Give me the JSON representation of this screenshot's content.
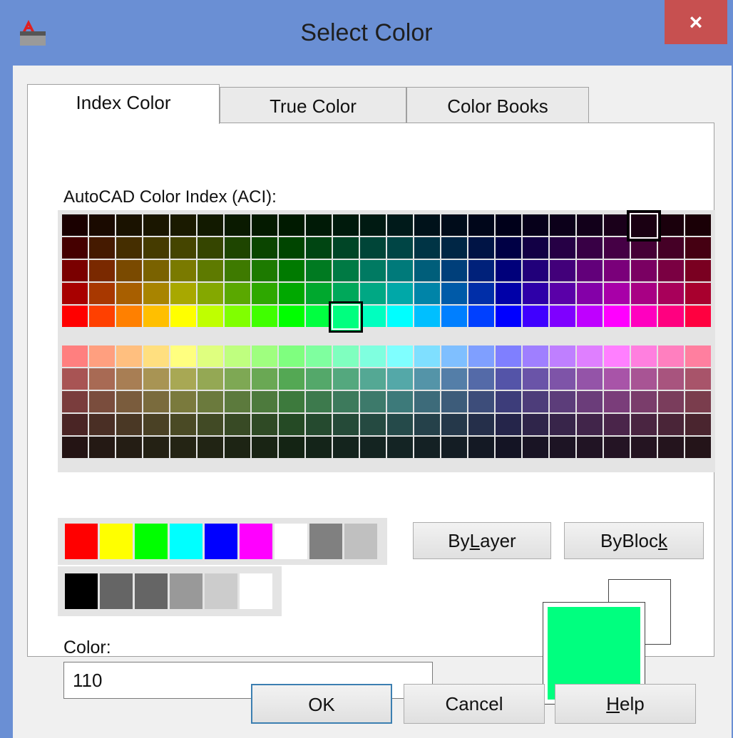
{
  "window": {
    "title": "Select Color",
    "close_glyph": "×",
    "app_icon": "autocad-a-icon"
  },
  "tabs": [
    {
      "label": "Index Color",
      "active": true
    },
    {
      "label": "True Color",
      "active": false
    },
    {
      "label": "Color Books",
      "active": false
    }
  ],
  "aci": {
    "label": "AutoCAD Color Index (ACI):",
    "top_rows": [
      [
        "#1a0000",
        "#1a0a00",
        "#1a1200",
        "#1a1600",
        "#1a1a00",
        "#121a00",
        "#0a1a00",
        "#041a00",
        "#001a00",
        "#001a06",
        "#001a0c",
        "#001a12",
        "#001a1a",
        "#00121a",
        "#000c1a",
        "#00061a",
        "#00001a",
        "#06001a",
        "#0c001a",
        "#12001a",
        "#1a001a",
        "#1a0012",
        "#1a000c",
        "#1a0006"
      ],
      [
        "#450000",
        "#451a00",
        "#452e00",
        "#453b00",
        "#454500",
        "#354500",
        "#1e4500",
        "#0b4500",
        "#004500",
        "#004512",
        "#004526",
        "#004538",
        "#004545",
        "#003445",
        "#002645",
        "#001445",
        "#000045",
        "#120045",
        "#260045",
        "#380045",
        "#450045",
        "#450036",
        "#450026",
        "#450012"
      ],
      [
        "#7a0000",
        "#7a2900",
        "#7a4a00",
        "#7a6200",
        "#7a7a00",
        "#5e7a00",
        "#3e7a00",
        "#1d7a00",
        "#007a00",
        "#007a21",
        "#007a44",
        "#007a62",
        "#007a7a",
        "#005e7a",
        "#003f7a",
        "#00217a",
        "#00007a",
        "#21007a",
        "#42007a",
        "#62007a",
        "#7a007a",
        "#7a0062",
        "#7a0042",
        "#7a0021"
      ],
      [
        "#a80000",
        "#a83800",
        "#a85f00",
        "#a88400",
        "#a8a800",
        "#84a800",
        "#5aa800",
        "#2ea800",
        "#00a800",
        "#00a82e",
        "#00a85a",
        "#00a884",
        "#00a8a8",
        "#0084a8",
        "#005aa8",
        "#002ea8",
        "#0000a8",
        "#2e00a8",
        "#5a00a8",
        "#8400a8",
        "#a800a8",
        "#a80084",
        "#a8005a",
        "#a8002e"
      ],
      [
        "#ff0000",
        "#ff4000",
        "#ff8000",
        "#ffbf00",
        "#ffff00",
        "#bfff00",
        "#80ff00",
        "#40ff00",
        "#00ff00",
        "#00ff40",
        "#00ff7f",
        "#00ffbf",
        "#00ffff",
        "#00bfff",
        "#007fff",
        "#0040ff",
        "#0000ff",
        "#4000ff",
        "#7f00ff",
        "#bf00ff",
        "#ff00ff",
        "#ff00bf",
        "#ff0080",
        "#ff0040"
      ]
    ],
    "bottom_rows": [
      [
        "#ff7f7f",
        "#ff9f7f",
        "#ffbf7f",
        "#ffdf7f",
        "#ffff7f",
        "#dfff7f",
        "#bfff7f",
        "#9fff7f",
        "#7fff7f",
        "#7fff9f",
        "#7fffbf",
        "#7fffdf",
        "#7fffff",
        "#7fdfff",
        "#7fbfff",
        "#7f9fff",
        "#7f7fff",
        "#9f7fff",
        "#bf7fff",
        "#df7fff",
        "#ff7fff",
        "#ff7fdf",
        "#ff7fbf",
        "#ff7f9f"
      ],
      [
        "#a85454",
        "#a86a54",
        "#a87e54",
        "#a89454",
        "#a8a854",
        "#94a854",
        "#7ea854",
        "#6aa854",
        "#54a854",
        "#54a86a",
        "#54a87e",
        "#54a894",
        "#54a8a8",
        "#5494a8",
        "#547ea8",
        "#546aa8",
        "#5454a8",
        "#6a54a8",
        "#7e54a8",
        "#9454a8",
        "#a854a8",
        "#a85494",
        "#a8547e",
        "#a8546a"
      ],
      [
        "#7a3d3d",
        "#7a4d3d",
        "#7a5c3d",
        "#7a6b3d",
        "#7a7a3d",
        "#6b7a3d",
        "#5c7a3d",
        "#4d7a3d",
        "#3d7a3d",
        "#3d7a4d",
        "#3d7a5c",
        "#3d7a6b",
        "#3d7a7a",
        "#3d6b7a",
        "#3d5c7a",
        "#3d4d7a",
        "#3d3d7a",
        "#4d3d7a",
        "#5c3d7a",
        "#6b3d7a",
        "#7a3d7a",
        "#7a3d6b",
        "#7a3d5c",
        "#7a3d4d"
      ],
      [
        "#4a2525",
        "#4a2f25",
        "#4a3825",
        "#4a4125",
        "#4a4a25",
        "#414a25",
        "#384a25",
        "#2f4a25",
        "#254a25",
        "#254a2f",
        "#254a38",
        "#254a41",
        "#254a4a",
        "#25414a",
        "#25384a",
        "#252f4a",
        "#25254a",
        "#2f254a",
        "#38254a",
        "#41254a",
        "#4a254a",
        "#4a2541",
        "#4a2538",
        "#4a252f"
      ],
      [
        "#241414",
        "#241914",
        "#241d14",
        "#242114",
        "#242414",
        "#212414",
        "#1d2414",
        "#192414",
        "#142414",
        "#142419",
        "#14241d",
        "#142421",
        "#142424",
        "#142124",
        "#141d24",
        "#141924",
        "#141424",
        "#191424",
        "#1d1424",
        "#211424",
        "#241424",
        "#241421",
        "#24141d",
        "#241419"
      ]
    ],
    "selected": {
      "row": 4,
      "col": 10
    },
    "hover": {
      "row": 0,
      "col": 21
    }
  },
  "standard_colors": [
    "#ff0000",
    "#ffff00",
    "#00ff00",
    "#00ffff",
    "#0000ff",
    "#ff00ff",
    "#ffffff",
    "#808080",
    "#c0c0c0"
  ],
  "gray_colors": [
    "#000000",
    "#656565",
    "#656565",
    "#999999",
    "#cccccc",
    "#ffffff"
  ],
  "buttons": {
    "bylayer_pre": "By",
    "bylayer_key": "L",
    "bylayer_post": "ayer",
    "byblock_pre": "ByBloc",
    "byblock_key": "k",
    "ok": "OK",
    "cancel": "Cancel",
    "help_key": "H",
    "help_post": "elp"
  },
  "color_field": {
    "label": "Color:",
    "value": "110"
  },
  "preview": {
    "new_color": "#00ff7f",
    "old_color": "#ffffff"
  }
}
